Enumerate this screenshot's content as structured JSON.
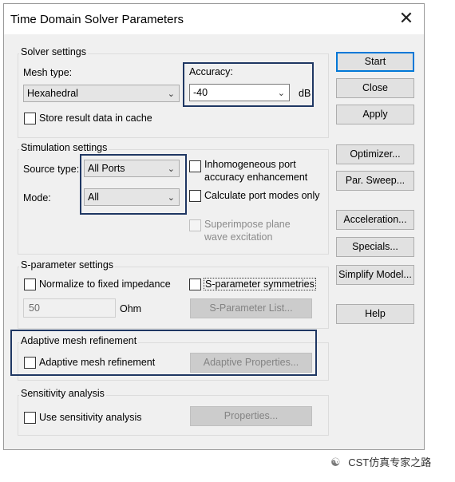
{
  "window": {
    "title": "Time Domain Solver Parameters",
    "close_glyph": "✕"
  },
  "solver": {
    "group_label": "Solver settings",
    "mesh_type_label": "Mesh type:",
    "mesh_type_value": "Hexahedral",
    "accuracy_label": "Accuracy:",
    "accuracy_value": "-40",
    "accuracy_unit": "dB",
    "store_cache_label": "Store result data in cache"
  },
  "stimulation": {
    "group_label": "Stimulation settings",
    "source_type_label": "Source type:",
    "source_type_value": "All Ports",
    "mode_label": "Mode:",
    "mode_value": "All",
    "inhomogeneous_label_1": "Inhomogeneous port",
    "inhomogeneous_label_2": "accuracy enhancement",
    "calc_port_modes_label": "Calculate port modes only",
    "superimpose_label_1": "Superimpose plane",
    "superimpose_label_2": "wave excitation"
  },
  "sparam": {
    "group_label": "S-parameter settings",
    "normalize_label": "Normalize to fixed impedance",
    "symmetries_label": "S-parameter symmetries",
    "impedance_value": "50",
    "impedance_unit": "Ohm",
    "list_button": "S-Parameter List..."
  },
  "adaptive": {
    "group_label": "Adaptive mesh refinement",
    "checkbox_label": "Adaptive mesh refinement",
    "properties_button": "Adaptive Properties..."
  },
  "sensitivity": {
    "group_label": "Sensitivity analysis",
    "checkbox_label": "Use sensitivity analysis",
    "properties_button": "Properties..."
  },
  "buttons": {
    "start": "Start",
    "close": "Close",
    "apply": "Apply",
    "optimizer": "Optimizer...",
    "par_sweep": "Par. Sweep...",
    "acceleration": "Acceleration...",
    "specials": "Specials...",
    "simplify_model": "Simplify Model...",
    "help": "Help"
  },
  "watermark": {
    "text": "CST仿真专家之路",
    "icon": "wechat-icon"
  },
  "colors": {
    "highlight": "#1f3763",
    "default_button_border": "#0078d7"
  }
}
